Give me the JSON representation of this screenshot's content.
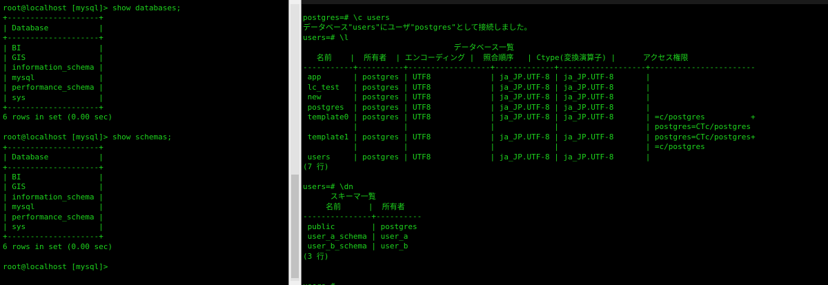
{
  "left_terminal": {
    "lines": [
      "root@localhost [mysql]> show databases;",
      "+--------------------+",
      "| Database           |",
      "+--------------------+",
      "| BI                 |",
      "| GIS                |",
      "| information_schema |",
      "| mysql              |",
      "| performance_schema |",
      "| sys                |",
      "+--------------------+",
      "6 rows in set (0.00 sec)",
      "",
      "root@localhost [mysql]> show schemas;",
      "+--------------------+",
      "| Database           |",
      "+--------------------+",
      "| BI                 |",
      "| GIS                |",
      "| information_schema |",
      "| mysql              |",
      "| performance_schema |",
      "| sys                |",
      "+--------------------+",
      "6 rows in set (0.00 sec)",
      "",
      "root@localhost [mysql]>"
    ]
  },
  "right_terminal": {
    "lines": [
      "postgres=# \\c users",
      "データベース\"users\"にユーザ\"postgres\"として接続しました。",
      "users=# \\l",
      "                                 データベース一覧",
      "   名前    |  所有者  | エンコーディング |  照合順序   | Ctype(変換演算子) |      アクセス権限",
      "-----------+----------+------------------+-------------+-------------------+-----------------------",
      " app       | postgres | UTF8             | ja_JP.UTF-8 | ja_JP.UTF-8       |",
      " lc_test   | postgres | UTF8             | ja_JP.UTF-8 | ja_JP.UTF-8       |",
      " new       | postgres | UTF8             | ja_JP.UTF-8 | ja_JP.UTF-8       |",
      " postgres  | postgres | UTF8             | ja_JP.UTF-8 | ja_JP.UTF-8       |",
      " template0 | postgres | UTF8             | ja_JP.UTF-8 | ja_JP.UTF-8       | =c/postgres          +",
      "           |          |                  |             |                   | postgres=CTc/postgres",
      " template1 | postgres | UTF8             | ja_JP.UTF-8 | ja_JP.UTF-8       | postgres=CTc/postgres+",
      "           |          |                  |             |                   | =c/postgres",
      " users     | postgres | UTF8             | ja_JP.UTF-8 | ja_JP.UTF-8       |",
      "(7 行)",
      "",
      "users=# \\dn",
      "      スキーマ一覧",
      "     名前      |  所有者",
      "---------------+----------",
      " public        | postgres",
      " user_a_schema | user_a",
      " user_b_schema | user_b",
      "(3 行)",
      "",
      "",
      "users=#"
    ]
  }
}
